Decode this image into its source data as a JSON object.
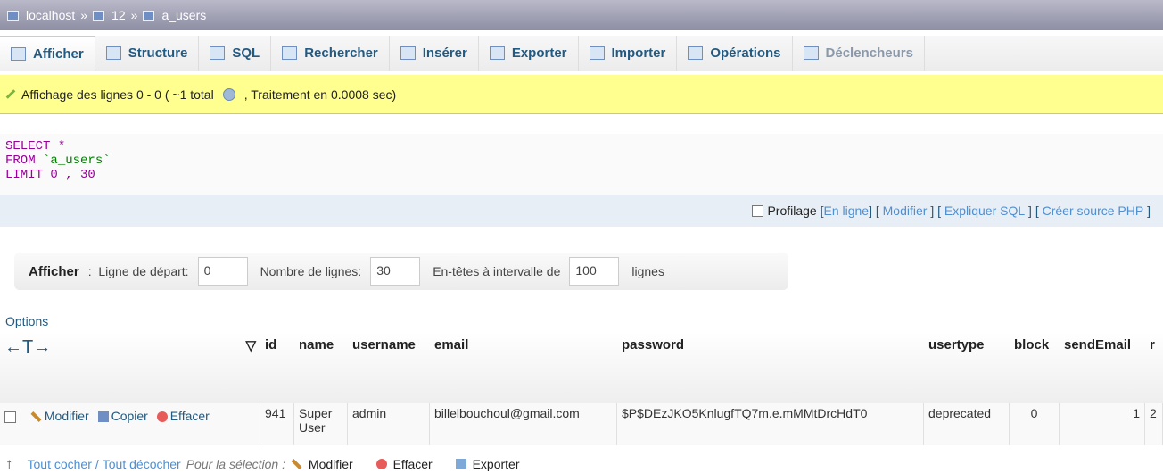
{
  "breadcrumb": {
    "server": "localhost",
    "sep1": "»",
    "db": "12",
    "sep2": "»",
    "table": "a_users"
  },
  "tabs": [
    {
      "label": "Afficher",
      "icon": "browse-icon"
    },
    {
      "label": "Structure",
      "icon": "structure-icon"
    },
    {
      "label": "SQL",
      "icon": "sql-icon"
    },
    {
      "label": "Rechercher",
      "icon": "search-icon"
    },
    {
      "label": "Insérer",
      "icon": "insert-icon"
    },
    {
      "label": "Exporter",
      "icon": "export-icon"
    },
    {
      "label": "Importer",
      "icon": "import-icon"
    },
    {
      "label": "Opérations",
      "icon": "operations-icon"
    },
    {
      "label": "Déclencheurs",
      "icon": "triggers-icon"
    }
  ],
  "notice": {
    "prefix": "Affichage des lignes 0 - 0 ( ~1 total",
    "suffix": ", Traitement en 0.0008 sec)"
  },
  "sql": {
    "line1_kw": "SELECT",
    "line1_rest": " *",
    "line2_kw": "FROM",
    "line2_str": " `a_users`",
    "line3_kw": "LIMIT",
    "line3_num": " 0 , 30"
  },
  "sqlbar": {
    "profiling": "Profilage",
    "inline": "En ligne",
    "edit": "Modifier",
    "explain": "Expliquer SQL",
    "create_php": "Créer source PHP"
  },
  "nav": {
    "show": "Afficher",
    "start_label": "Ligne de départ:",
    "start_value": "0",
    "rows_label": "Nombre de lignes:",
    "rows_value": "30",
    "headers_label": "En-têtes à intervalle de",
    "headers_value": "100",
    "lines": "lignes"
  },
  "options_link": "Options",
  "columns": [
    "id",
    "name",
    "username",
    "email",
    "password",
    "usertype",
    "block",
    "sendEmail",
    "r"
  ],
  "row": {
    "actions": {
      "edit": "Modifier",
      "copy": "Copier",
      "delete": "Effacer"
    },
    "id": "941",
    "name": "Super User",
    "username": "admin",
    "email": "billelbouchoul@gmail.com",
    "password": "$P$DEzJKO5KnlugfTQ7m.e.mMMtDrcHdT0",
    "usertype": "deprecated",
    "block": "0",
    "sendEmail": "1",
    "r": "2"
  },
  "footer": {
    "check_all": "Tout cocher",
    "slash": "/",
    "uncheck_all": "Tout décocher",
    "for_selection": "Pour la sélection :",
    "edit": "Modifier",
    "delete": "Effacer",
    "export": "Exporter"
  }
}
